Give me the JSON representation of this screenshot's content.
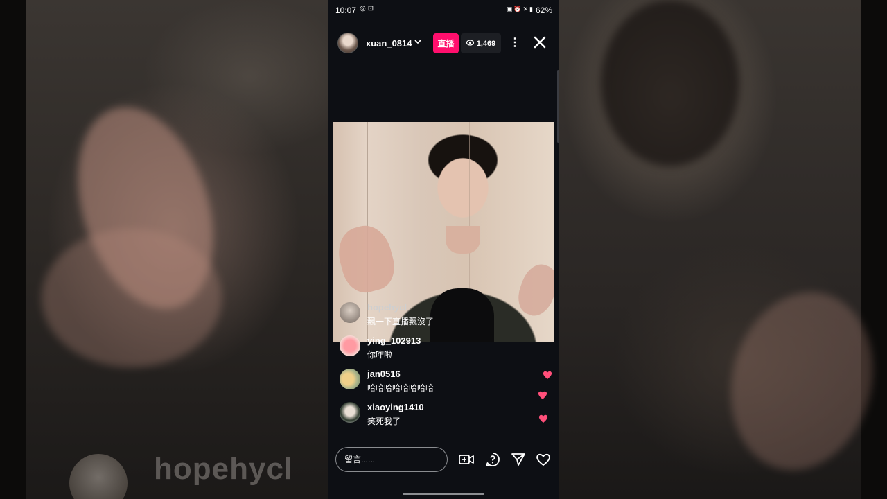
{
  "status_bar": {
    "time": "10:07",
    "left_icons": [
      "instagram-icon",
      "screen-record-icon"
    ],
    "right_icons": [
      "battery-saver-icon",
      "alarm-icon",
      "mute-icon",
      "volte-icon",
      "signal-icon"
    ],
    "battery": "62%"
  },
  "live": {
    "host_username": "xuan_0814",
    "live_label": "直播",
    "viewer_count": "1,469"
  },
  "comments": [
    {
      "username": "hopehycl",
      "text": "飄一下直播飄沒了"
    },
    {
      "username": "ying_102913",
      "text": "你咋啦"
    },
    {
      "username": "jan0516",
      "text": "哈哈哈哈哈哈哈哈"
    },
    {
      "username": "xiaoying1410",
      "text": "笑死我了"
    }
  ],
  "input": {
    "placeholder": "留言......"
  },
  "background": {
    "ghost_username": "hopehycl"
  },
  "colors": {
    "live_badge": "#ff0f6d",
    "heart": "#ff3b6b",
    "phone_bg": "#0d0f14"
  }
}
